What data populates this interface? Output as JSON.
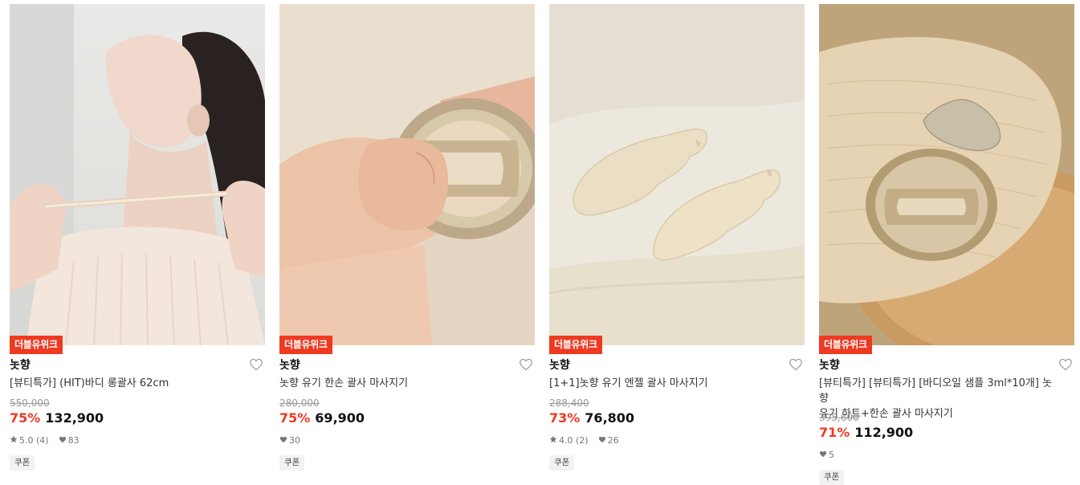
{
  "products": [
    {
      "badge": "더블유위크",
      "brand": "놋향",
      "name": "[뷰티특가] (HIT)바디 롱괄사 62cm",
      "original_price": "550,000",
      "discount": "75%",
      "price": "132,900",
      "rating": "5.0",
      "review_count": "(4)",
      "likes": "83",
      "coupon": "쿠폰"
    },
    {
      "badge": "더블유위크",
      "brand": "놋향",
      "name": "놋향 유기 한손 괄사 마사지기",
      "original_price": "280,000",
      "discount": "75%",
      "price": "69,900",
      "likes": "30",
      "coupon": "쿠폰"
    },
    {
      "badge": "더블유위크",
      "brand": "놋향",
      "name": "[1+1]놋향 유기 엔젤 괄사 마사지기",
      "original_price": "288,400",
      "discount": "73%",
      "price": "76,800",
      "rating": "4.0",
      "review_count": "(2)",
      "likes": "26",
      "coupon": "쿠폰"
    },
    {
      "badge": "더블유위크",
      "brand": "놋향",
      "name_line1": "[뷰티특가] [뷰티특가] [바디오일 샘플 3ml*10개] 놋향",
      "name_line2": "유기 하트+한손 괄사 마사지기",
      "original_price": "395,600",
      "discount": "71%",
      "price": "112,900",
      "likes": "5",
      "coupon": "쿠폰"
    }
  ],
  "icons": {
    "wishlist": "heart-outline-icon",
    "rating": "star-icon",
    "likes": "heart-filled-icon"
  },
  "colors": {
    "accent": "#ef3a22",
    "muted": "#999999",
    "coupon_bg": "#f2f2f2"
  }
}
